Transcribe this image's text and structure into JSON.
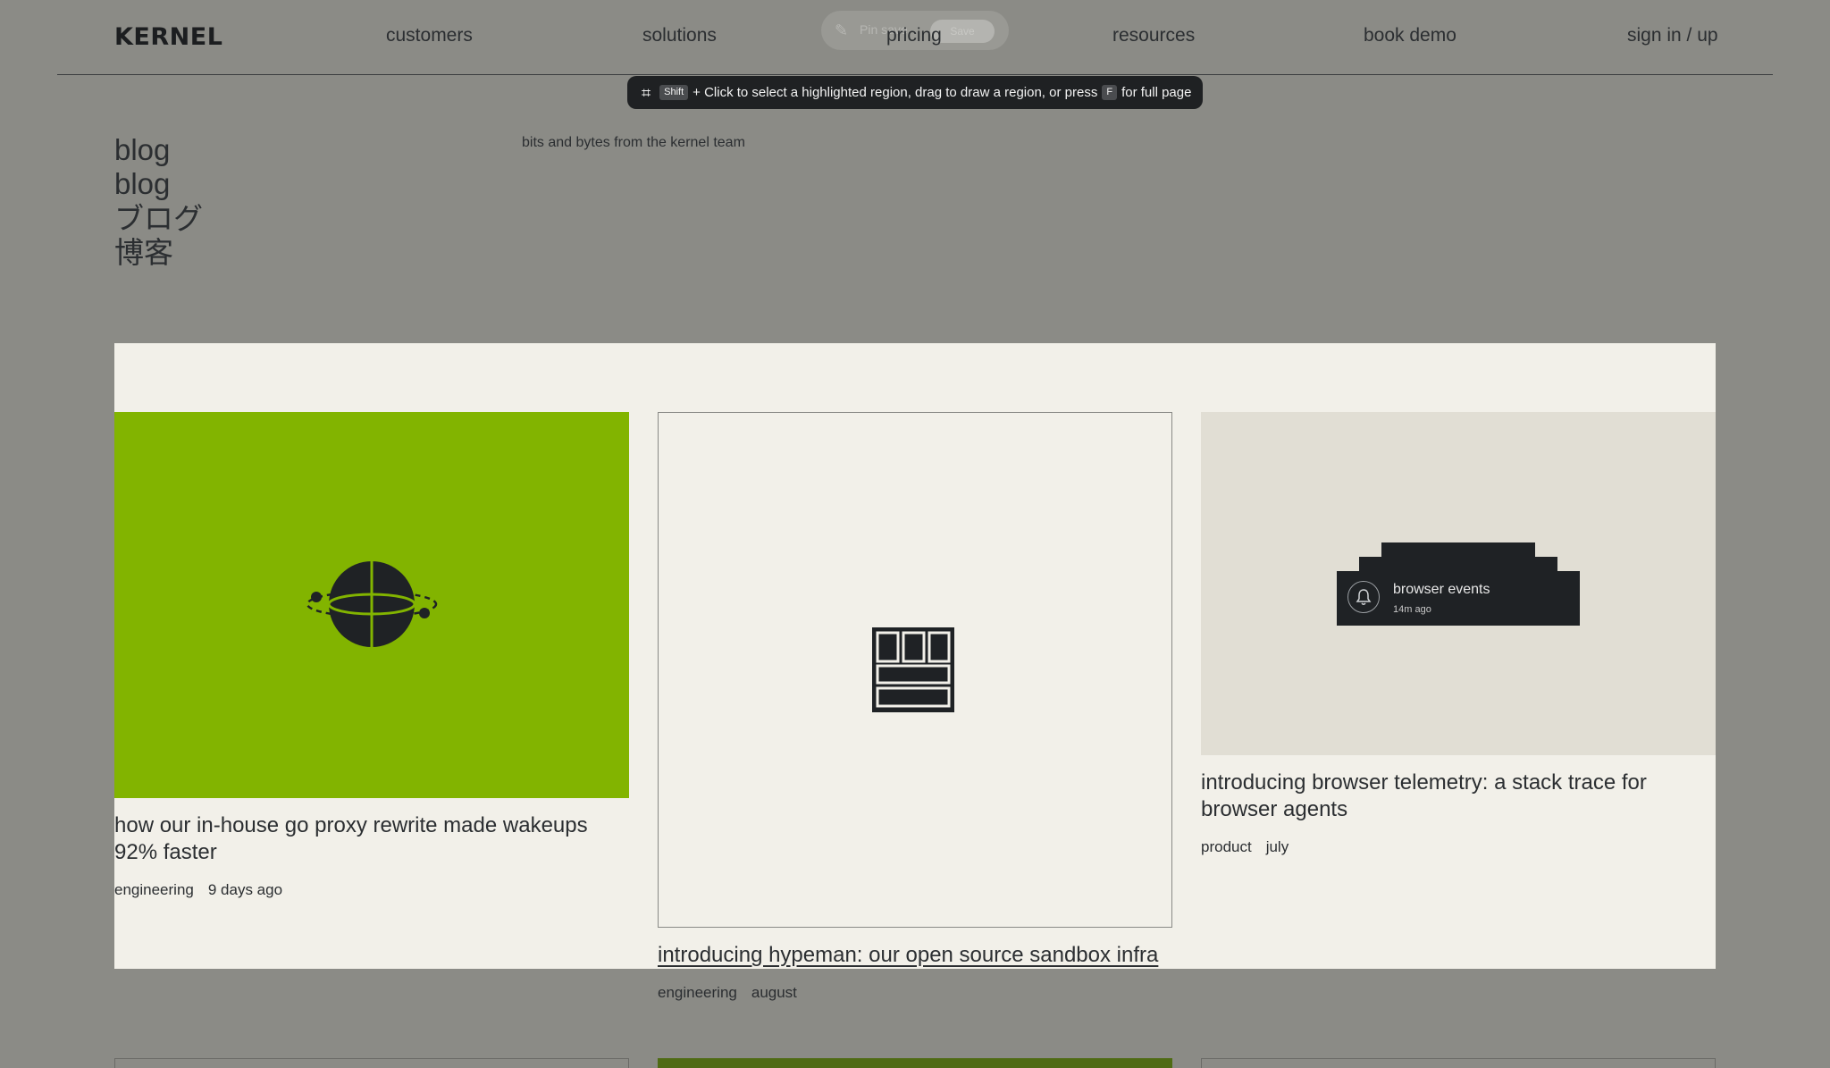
{
  "header": {
    "logo": "KERNEL",
    "nav": [
      "customers",
      "solutions",
      "pricing",
      "resources",
      "book demo"
    ],
    "auth": "sign in / up"
  },
  "pin_overlay": {
    "label": "Pin save",
    "button": "Save"
  },
  "tooltip": {
    "key_shift": "Shift",
    "text_1": "+ Click to select a highlighted region, drag to draw a region, or press",
    "key_full": "F",
    "text_2": "for full page"
  },
  "hero": {
    "titles": [
      "blog",
      "blog",
      "ブログ",
      "博客"
    ],
    "tagline": "bits and bytes from the kernel team"
  },
  "posts": [
    {
      "title": "how our in-house go proxy rewrite made wakeups 92% faster",
      "category": "engineering",
      "date": "9 days ago",
      "image_icon": "globe-orbit-icon",
      "image_color": "#82b400"
    },
    {
      "title": "introducing hypeman: our open source sandbox infra",
      "category": "engineering",
      "date": "august",
      "image_icon": "grid-window-icon"
    },
    {
      "title": "introducing browser telemetry: a stack trace for browser agents",
      "category": "product",
      "date": "july",
      "image_icon": "bell-icon",
      "event": {
        "title": "browser events",
        "time": "14m ago"
      }
    }
  ]
}
